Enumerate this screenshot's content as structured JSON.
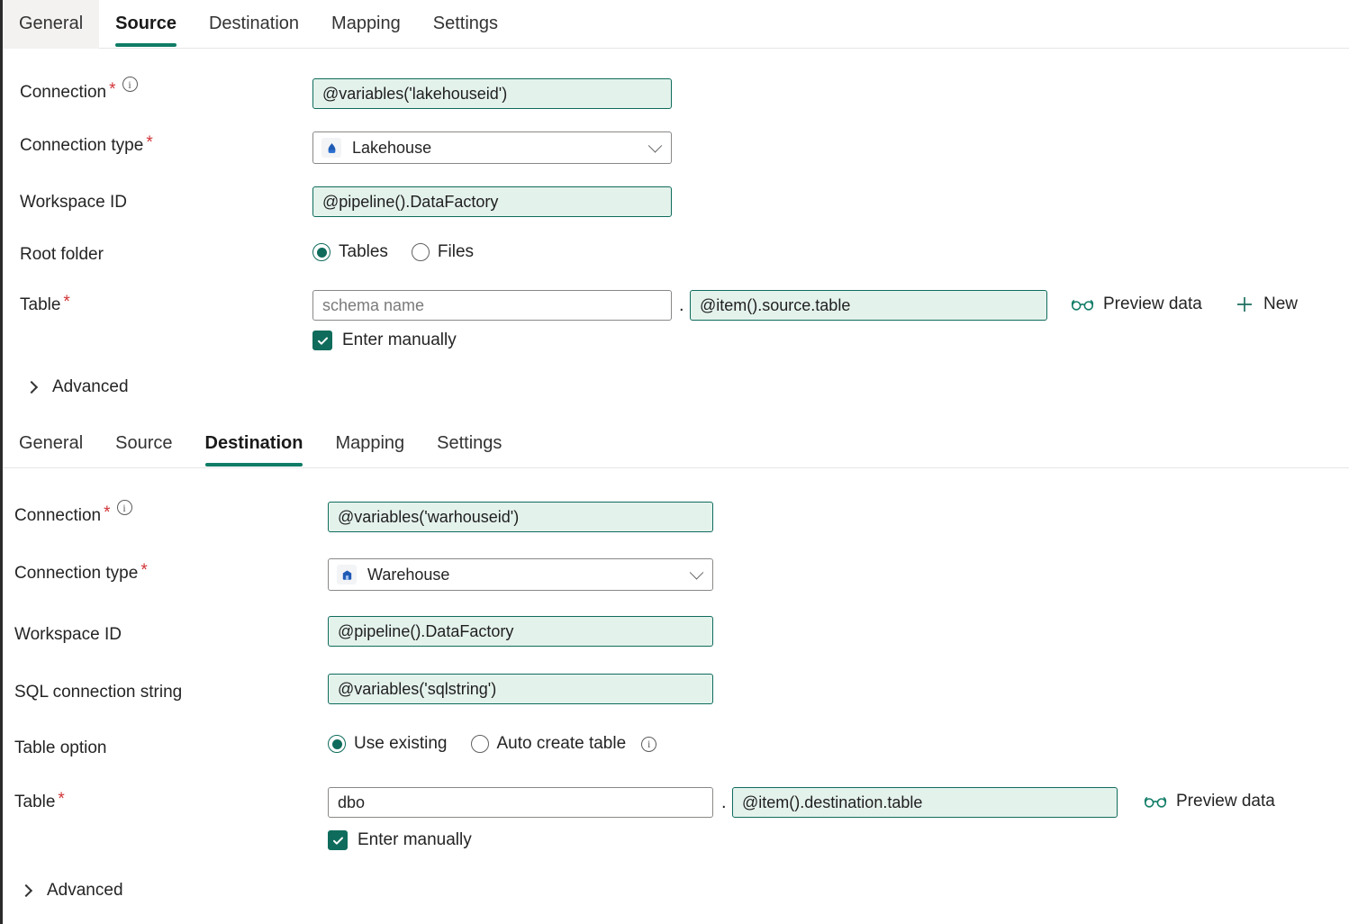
{
  "source_tabs": [
    {
      "label": "General",
      "state": "hover"
    },
    {
      "label": "Source",
      "state": "active"
    },
    {
      "label": "Destination",
      "state": "normal"
    },
    {
      "label": "Mapping",
      "state": "normal"
    },
    {
      "label": "Settings",
      "state": "normal"
    }
  ],
  "destination_tabs": [
    {
      "label": "General",
      "state": "normal"
    },
    {
      "label": "Source",
      "state": "normal"
    },
    {
      "label": "Destination",
      "state": "active"
    },
    {
      "label": "Mapping",
      "state": "normal"
    },
    {
      "label": "Settings",
      "state": "normal"
    }
  ],
  "source": {
    "connection_label": "Connection",
    "connection_value": "@variables('lakehouseid')",
    "connection_type_label": "Connection type",
    "connection_type_value": "Lakehouse",
    "connection_type_icon": "lakehouse-icon",
    "workspace_id_label": "Workspace ID",
    "workspace_id_value": "@pipeline().DataFactory",
    "root_folder_label": "Root folder",
    "root_folder_options": [
      {
        "label": "Tables",
        "selected": true
      },
      {
        "label": "Files",
        "selected": false
      }
    ],
    "table_label": "Table",
    "schema_placeholder": "schema name",
    "schema_value": "",
    "separator": ".",
    "table_value": "@item().source.table",
    "preview_data_label": "Preview data",
    "new_label": "New",
    "enter_manually_label": "Enter manually",
    "enter_manually_checked": true,
    "advanced_label": "Advanced"
  },
  "destination": {
    "connection_label": "Connection",
    "connection_value": "@variables('warhouseid')",
    "connection_type_label": "Connection type",
    "connection_type_value": "Warehouse",
    "connection_type_icon": "warehouse-icon",
    "workspace_id_label": "Workspace ID",
    "workspace_id_value": "@pipeline().DataFactory",
    "sql_connection_string_label": "SQL connection string",
    "sql_connection_string_value": "@variables('sqlstring')",
    "table_option_label": "Table option",
    "table_options": [
      {
        "label": "Use existing",
        "selected": true
      },
      {
        "label": "Auto create table",
        "selected": false
      }
    ],
    "table_label": "Table",
    "schema_value": "dbo",
    "separator": ".",
    "table_value": "@item().destination.table",
    "preview_data_label": "Preview data",
    "enter_manually_label": "Enter manually",
    "enter_manually_checked": true,
    "advanced_label": "Advanced"
  },
  "colors": {
    "accent": "#107c66",
    "expression_border": "#0f6c5c",
    "expression_bg": "#e4f2ec",
    "required_asterisk": "#d13438",
    "product_icon_blue": "#1f5bb5"
  }
}
